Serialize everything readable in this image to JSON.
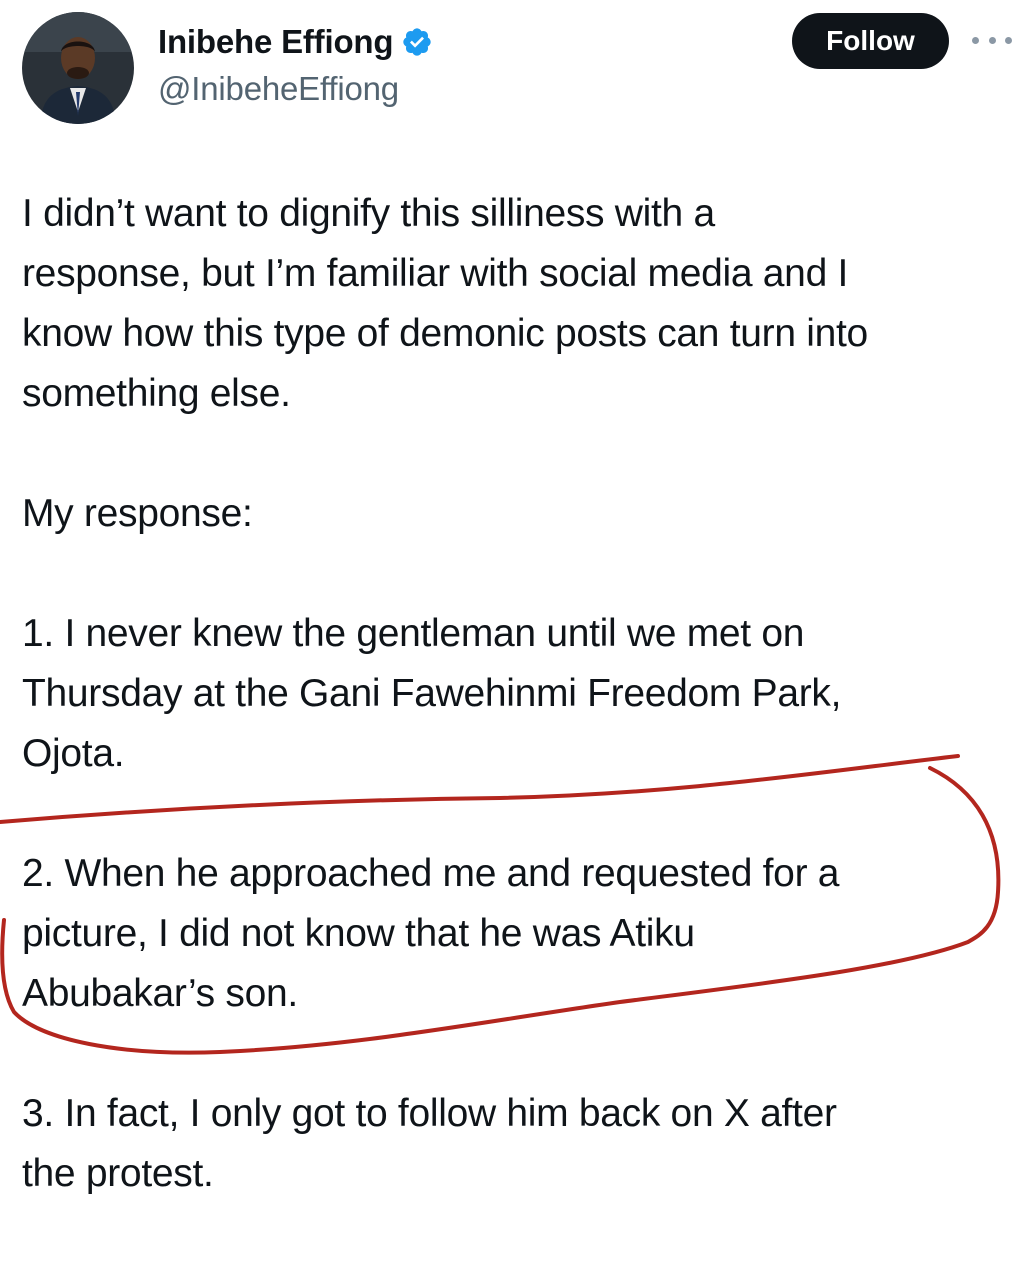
{
  "tweet": {
    "author": {
      "display_name": "Inibehe Effiong",
      "handle": "@InibeheEffiong",
      "verified": true,
      "avatar_icon": "profile-photo"
    },
    "actions": {
      "follow_label": "Follow",
      "more_icon": "ellipsis-icon"
    },
    "paragraphs": [
      "I didn’t want to dignify this silliness with a\nresponse, but I’m familiar with social media and I\nknow how this type of demonic posts can turn into\nsomething else.",
      "My response:",
      "1. I never knew the gentleman until we met on\nThursday at the Gani Fawehinmi Freedom Park,\nOjota.",
      "2. When he approached me and requested for a\npicture, I did not know that he was Atiku\nAbubakar’s son.",
      "3. In fact, I only got to follow him back on X after\nthe protest."
    ]
  },
  "colors": {
    "text": "#0f1419",
    "secondary_text": "#536471",
    "verified_badge": "#1d9bf0",
    "follow_button_bg": "#0f1419",
    "annotation": "#b3261e"
  }
}
